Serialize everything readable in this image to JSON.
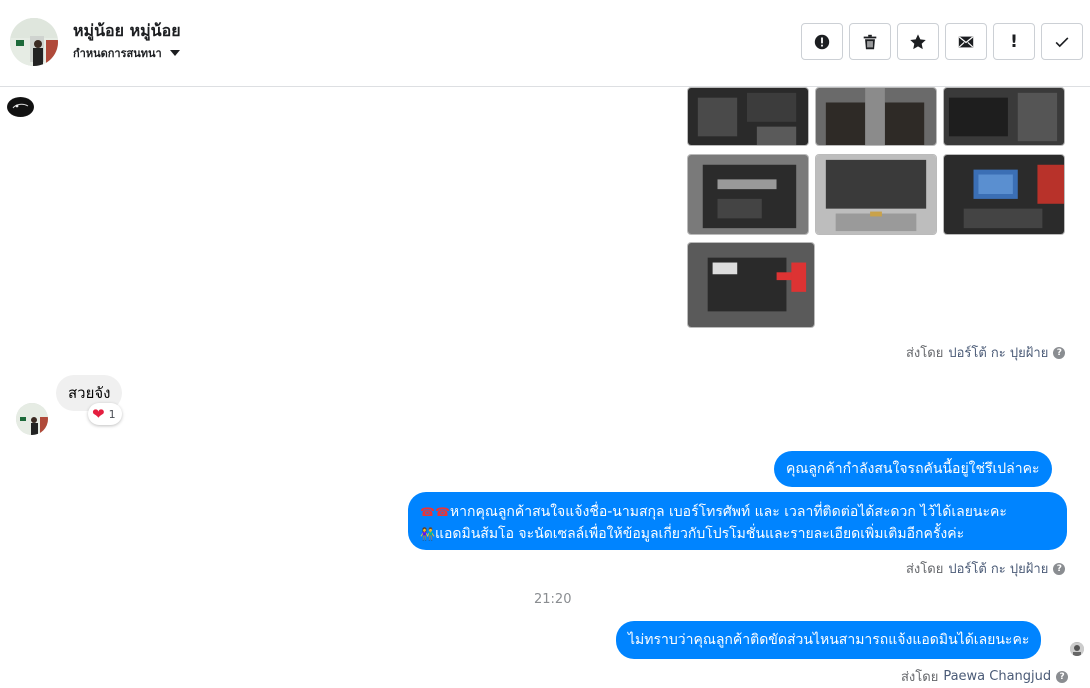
{
  "header": {
    "name": "หมู่น้อย หมู่น้อย",
    "subtitle": "กำหนดการสนทนา"
  },
  "toolbar": [
    {
      "name": "report-button",
      "icon": "alert-circle-icon"
    },
    {
      "name": "delete-button",
      "icon": "trash-icon"
    },
    {
      "name": "star-button",
      "icon": "star-icon"
    },
    {
      "name": "mark-unread-button",
      "icon": "envelope-icon"
    },
    {
      "name": "important-button",
      "icon": "exclamation-icon",
      "text": "!"
    },
    {
      "name": "done-button",
      "icon": "check-icon"
    }
  ],
  "thread": {
    "sent_by_1": {
      "prefix": "ส่งโดย",
      "name": "ปอร์โต้ กะ ปุยฝ้าย"
    },
    "incoming_message": "สวยจัง",
    "reaction": {
      "emoji": "❤",
      "count": "1"
    },
    "outgoing_1": "คุณลูกค้ากำลังสนใจรถคันนี้อยู่ใช่รึเปล่าคะ",
    "outgoing_2_line1_icons": "☎☎",
    "outgoing_2_line1": "หากคุณลูกค้าสนใจแจ้งชื่อ-นามสกุล เบอร์โทรศัพท์ และ เวลาที่ติดต่อได้สะดวก ไว้ได้เลยนะคะ",
    "outgoing_2_line2_icons": "👫",
    "outgoing_2_line2": "แอดมินส้มโอ จะนัดเซลล์เพื่อให้ข้อมูลเกี่ยวกับโปรโมชั่นและรายละเอียดเพิ่มเติมอีกครั้งค่ะ",
    "sent_by_2": {
      "prefix": "ส่งโดย",
      "name": "ปอร์โต้ กะ ปุยฝ้าย"
    },
    "time": "21:20",
    "outgoing_3": "ไม่ทราบว่าคุณลูกค้าติดขัดส่วนไหนสามารถแจ้งแอดมินได้เลยนะคะ",
    "sent_by_3": {
      "prefix": "ส่งโดย",
      "name": "Paewa Changjud"
    }
  },
  "colors": {
    "accent": "#0084ff",
    "incoming_bg": "#f0f0f0",
    "meta_text": "#65676b"
  }
}
